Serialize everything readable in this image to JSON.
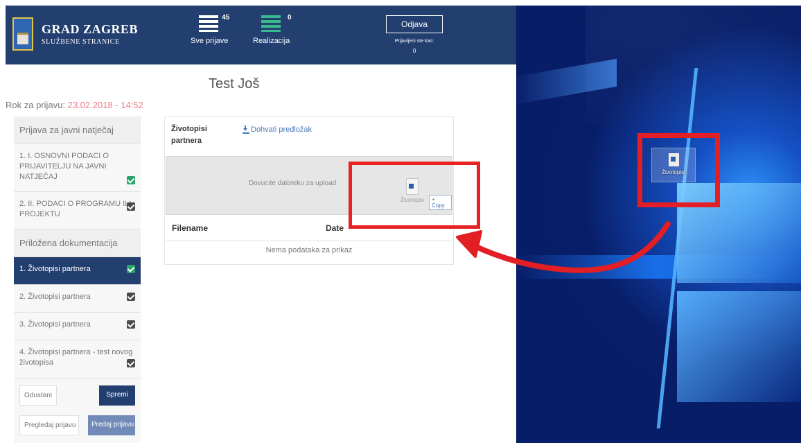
{
  "header": {
    "logo_title": "GRAD ZAGREB",
    "logo_subtitle": "SLUŽBENE STRANICE",
    "nav_items": [
      {
        "label": "Sve prijave",
        "count": "45",
        "icon": "list-icon"
      },
      {
        "label": "Realizacija",
        "count": "0",
        "icon": "list-green-icon"
      }
    ],
    "logout_label": "Odjava",
    "logged_in_text": "Prijavljeni ste kao:",
    "logged_in_value": "0"
  },
  "page": {
    "title": "Test Još",
    "deadline_label": "Rok za prijavu: ",
    "deadline_value": "23.02.2018 - 14:52"
  },
  "sidebar": {
    "section_1": "Prijava za javni natječaj",
    "items": [
      {
        "label": "1. I. OSNOVNI PODACI O PRIJAVITELJU NA JAVNI NATJEČAJ",
        "status": "green"
      },
      {
        "label": "2. II. PODACI O PROGRAMU ILI PROJEKTU",
        "status": "dark"
      }
    ],
    "section_2": "Priložena dokumentacija",
    "docs": [
      {
        "label": "1. Životopisi partnera",
        "status": "green",
        "active": true
      },
      {
        "label": "2. Životopisi partnera",
        "status": "dark",
        "active": false
      },
      {
        "label": "3. Životopisi partnera",
        "status": "dark",
        "active": false
      },
      {
        "label": "4. Životopisi partnera - test novog životopisa",
        "status": "dark",
        "active": false
      }
    ],
    "buttons": {
      "cancel": "Odustani",
      "save": "Spremi",
      "preview": "Pregledaj prijavu",
      "submit": "Predaj prijavu"
    }
  },
  "main": {
    "section_label": "Životopisi partnera",
    "template_link": "Dohvati predložak",
    "dropzone_text": "Dovucite datoteku za upload",
    "drag_file_name": "Životopisi",
    "copy_label": "+ Copy",
    "table_headers": [
      "Filename",
      "Date"
    ],
    "empty_message": "Nema podataka za prikaz"
  },
  "desktop": {
    "file_name": "Životopisi"
  },
  "colors": {
    "header_blue": "#233f6f",
    "accent_red": "#e62223",
    "success_green": "#2aa46b",
    "link_blue": "#4678ba"
  }
}
